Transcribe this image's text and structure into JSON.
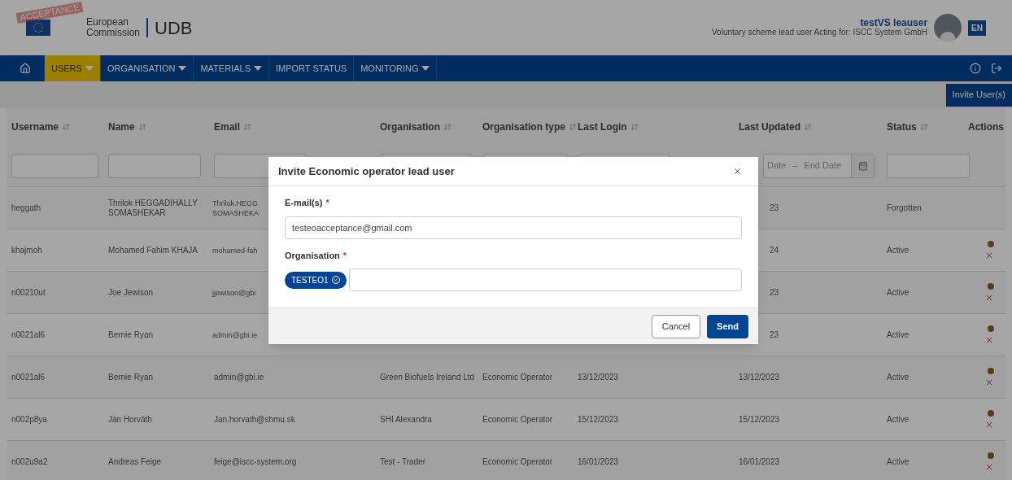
{
  "header": {
    "stamp": "ACCEPTANCE",
    "org_line1": "European",
    "org_line2": "Commission",
    "app": "UDB",
    "user_name": "testVS leauser",
    "user_role": "Voluntary scheme lead user Acting for: ISCC System GmbH",
    "language": "EN"
  },
  "nav": [
    {
      "label": "USERS",
      "has_menu": true,
      "selected": true
    },
    {
      "label": "ORGANISATION",
      "has_menu": true,
      "selected": false
    },
    {
      "label": "MATERIALS",
      "has_menu": true,
      "selected": false
    },
    {
      "label": "IMPORT STATUS",
      "has_menu": false,
      "selected": false
    },
    {
      "label": "MONITORING",
      "has_menu": true,
      "selected": false
    }
  ],
  "invite_button": "Invite User(s)",
  "table": {
    "columns": [
      {
        "label": "Username",
        "sortable": true
      },
      {
        "label": "Name",
        "sortable": true
      },
      {
        "label": "Email",
        "sortable": true
      },
      {
        "label": "Organisation",
        "sortable": true
      },
      {
        "label": "Organisation type",
        "sortable": true
      },
      {
        "label": "Last Login",
        "sortable": true
      },
      {
        "label": "Last Updated",
        "sortable": true
      },
      {
        "label": "Status",
        "sortable": true
      },
      {
        "label": "Actions",
        "sortable": false
      }
    ],
    "date_filter": {
      "start": "Date",
      "separator": "–",
      "end": "End Date"
    },
    "rows": [
      {
        "under_dialog": true,
        "cells": [
          "heggath",
          "Thrilok HEGGADIHALLY SOMASHEKAR",
          "Thrilok.HEGG SOMASHEKA",
          "",
          "",
          "",
          "23",
          "Forgotten"
        ],
        "actions": false
      },
      {
        "under_dialog": true,
        "cells": [
          "khajmoh",
          "Mohamed Fahim KHAJA",
          "mohamed-fah",
          "",
          "",
          "",
          "24",
          "Active"
        ],
        "actions": true
      },
      {
        "under_dialog": true,
        "cells": [
          "n00210ut",
          "Joe Jewison",
          "jjewison@gbi",
          "",
          "",
          "",
          "23",
          "Active"
        ],
        "actions": true
      },
      {
        "under_dialog": true,
        "cells": [
          "n0021al6",
          "Bernie Ryan",
          "admin@gbi.ie",
          "",
          "",
          "",
          "23",
          "Active"
        ],
        "actions": true
      },
      {
        "under_dialog": false,
        "cells": [
          "n0021al6",
          "Bernie Ryan",
          "admin@gbi.ie",
          "Green Biofuels Ireland Ltd",
          "Economic Operator",
          "13/12/2023",
          "13/12/2023",
          "Active"
        ],
        "actions": true
      },
      {
        "under_dialog": false,
        "cells": [
          "n002p8ya",
          "Ján Horváth",
          "Jan.horvath@shmu.sk",
          "SHI Alexandra",
          "Economic Operator",
          "15/12/2023",
          "15/12/2023",
          "Active"
        ],
        "actions": true
      },
      {
        "under_dialog": false,
        "cells": [
          "n002u9a2",
          "Andreas Feige",
          "feige@iscc-system.org",
          "Test - Trader",
          "Economic Operator",
          "16/01/2023",
          "16/01/2023",
          "Active"
        ],
        "actions": true
      }
    ]
  },
  "dialog": {
    "title": "Invite Economic operator lead user",
    "email_label": "E-mail(s)",
    "email_required_mark": "*",
    "email_value": "testeoacceptance@gmail.com",
    "org_label": "Organisation",
    "org_required_mark": "*",
    "org_tags": [
      "TESTEO1"
    ],
    "cancel": "Cancel",
    "send": "Send"
  }
}
